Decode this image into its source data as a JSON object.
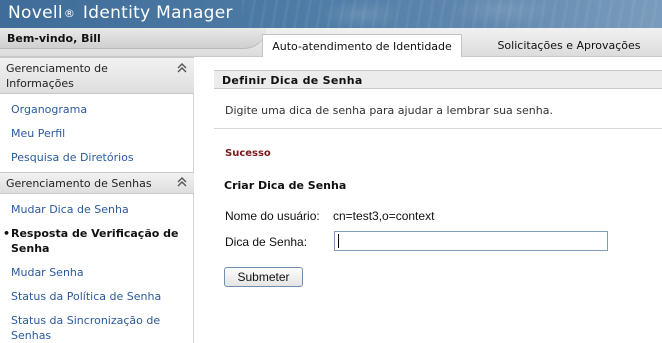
{
  "header": {
    "brand_prefix": "Novell",
    "brand_reg": "®",
    "brand_suffix": "Identity Manager",
    "welcome": "Bem-vindo, Bill",
    "tabs": [
      {
        "label": "Auto-atendimento de Identidade",
        "active": true
      },
      {
        "label": "Solicitações e Aprovações",
        "active": false
      }
    ]
  },
  "sidebar": {
    "sections": [
      {
        "title": "Gerenciamento de Informações",
        "collapse_icon": "double-chevron-up-icon",
        "items": [
          {
            "label": "Organograma"
          },
          {
            "label": "Meu Perfil"
          },
          {
            "label": "Pesquisa de Diretórios"
          }
        ]
      },
      {
        "title": "Gerenciamento de Senhas",
        "collapse_icon": "double-chevron-up-icon",
        "items": [
          {
            "label": "Mudar Dica de Senha"
          },
          {
            "label": "Resposta de Verificação de Senha",
            "current": true,
            "bullet": "•"
          },
          {
            "label": "Mudar Senha"
          },
          {
            "label": "Status da Política de Senha"
          },
          {
            "label": "Status da Sincronização de Senhas"
          }
        ]
      }
    ]
  },
  "main": {
    "title": "Definir Dica de Senha",
    "description": "Digite uma dica de senha para ajudar a lembrar sua senha.",
    "status": "Sucesso",
    "form_title": "Criar Dica de Senha",
    "username_label": "Nome do usuário:",
    "username_value": "cn=test3,o=context",
    "hint_label": "Dica de Senha:",
    "hint_value": "",
    "submit_label": "Submeter"
  },
  "colors": {
    "banner": "#4d7ba6",
    "link": "#2a5a9c",
    "success": "#7a1a1a",
    "input_border": "#7f9db9"
  }
}
